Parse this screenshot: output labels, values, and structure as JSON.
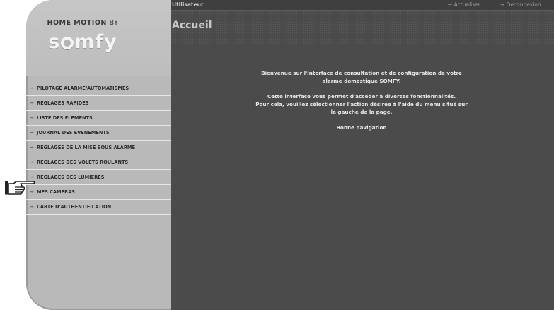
{
  "brand": {
    "prefix": "HOME MOTION",
    "by": "BY",
    "logo": "somfy"
  },
  "topbar": {
    "user_label": "Utilisateur",
    "refresh_label": "↩ Actualiser",
    "logout_label": "→ Deconnexion"
  },
  "page": {
    "title": "Accueil"
  },
  "welcome": {
    "p1": "Bienvenue sur l'interface de consultation et de configuration de votre alarme domestique SOMFY.",
    "p2a": "Cette interface vous permet d'accéder à diverses fonctionnalités.",
    "p2b": "Pour cela, veuillez sélectionner l'action désirée à l'aide du menu situé sur la gauche de la page.",
    "p3": "Bonne navigation"
  },
  "menu": {
    "arrow": "→",
    "items": [
      {
        "label": "PILOTAGE ALARME/AUTOMATISMES"
      },
      {
        "label": "REGLAGES RAPIDES"
      },
      {
        "label": "LISTE DES ELEMENTS"
      },
      {
        "label": "JOURNAL DES EVENEMENTS"
      },
      {
        "label": "REGLAGES DE LA MISE SOUS ALARME"
      },
      {
        "label": "REGLAGES DES VOLETS ROULANTS"
      },
      {
        "label": "REGLAGES DES LUMIERES"
      },
      {
        "label": "MES CAMERAS"
      },
      {
        "label": "CARTE D'AUTHENTIFICATION"
      }
    ]
  },
  "colors": {
    "sidebar": "#b9b9b9",
    "main": "#4b4b4b",
    "topbar": "#3f3f3f"
  },
  "icons": {
    "pointer": "pointing-hand-icon",
    "menu_arrow": "arrow-right-icon"
  }
}
